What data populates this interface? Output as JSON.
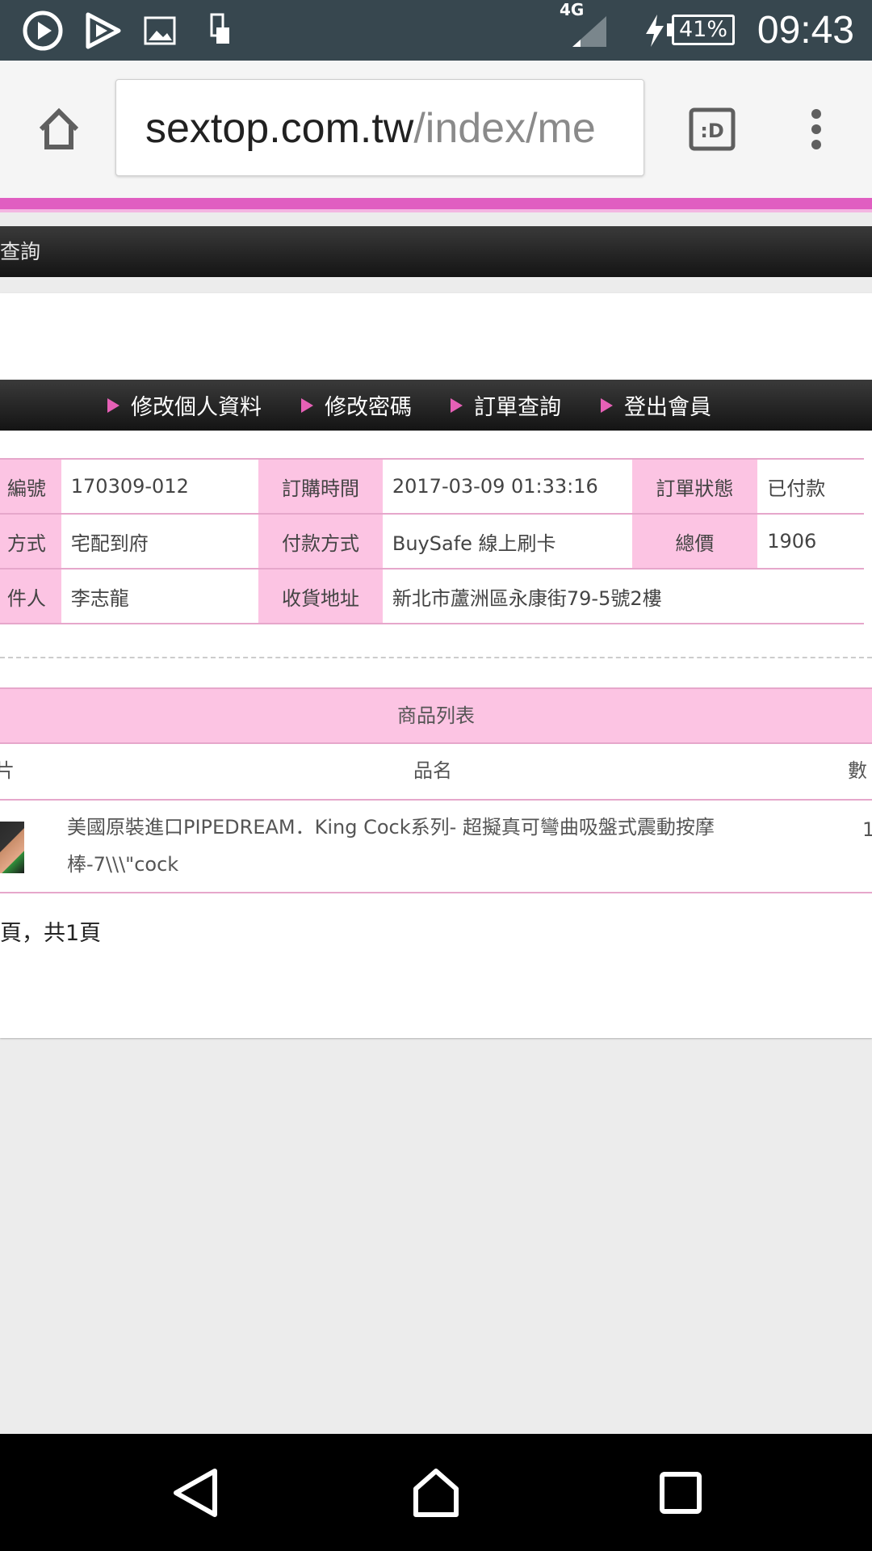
{
  "status_bar": {
    "network": "4G",
    "battery": "41%",
    "time": "09:43"
  },
  "browser": {
    "url_host": "sextop.com.tw",
    "url_path": "/index/me"
  },
  "page": {
    "top_bar_text": "查詢",
    "member_nav": [
      "修改個人資料",
      "修改密碼",
      "訂單查詢",
      "登出會員"
    ],
    "order_info": [
      [
        {
          "label": "編號",
          "value": "170309-012"
        },
        {
          "label": "訂購時間",
          "value": "2017-03-09 01:33:16"
        },
        {
          "label": "訂單狀態",
          "value": "已付款"
        }
      ],
      [
        {
          "label": "方式",
          "value": "宅配到府"
        },
        {
          "label": "付款方式",
          "value": "BuySafe 線上刷卡"
        },
        {
          "label": "總價",
          "value": "1906"
        }
      ],
      [
        {
          "label": "件人",
          "value": "李志龍"
        },
        {
          "label": "收貨地址",
          "value": "新北市蘆洲區永康街79-5號2樓"
        }
      ]
    ],
    "product_list_title": "商品列表",
    "columns": {
      "image": "片",
      "name": "品名",
      "qty": "數"
    },
    "products": [
      {
        "name": "美國原裝進口PIPEDREAM．King Cock系列- 超擬真可彎曲吸盤式震動按摩棒-7\\\\\\\"cock",
        "qty": "1"
      }
    ],
    "pagination": "頁，共1頁"
  },
  "colors": {
    "status_bar": "#37474f",
    "accent_pink": "#e05ec1",
    "label_pink": "#fcc4e3",
    "border_pink": "#e6a7cb"
  }
}
